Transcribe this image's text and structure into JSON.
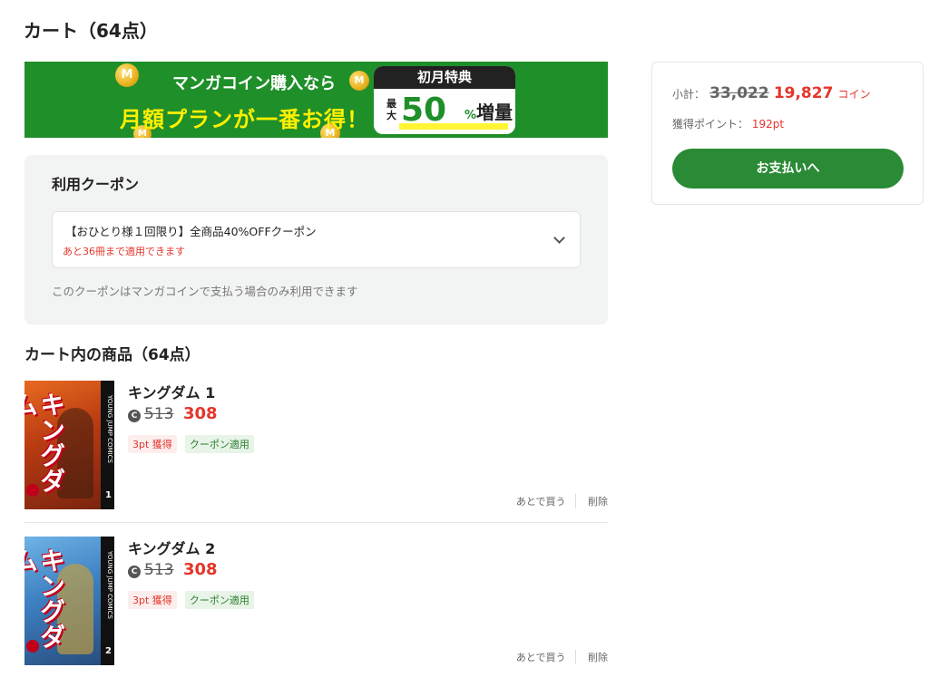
{
  "page": {
    "title": "カート（64点）"
  },
  "banner": {
    "line1": "マンガコイン購入なら",
    "line2": "月額プランが一番お得！",
    "badge_head": "初月特典",
    "badge_small": "最大",
    "badge_big": "50",
    "badge_pct": "%",
    "badge_word": "増量",
    "coin_letter": "M"
  },
  "coupon": {
    "title": "利用クーポン",
    "selected": "【おひとり様１回限り】全商品40%OFFクーポン",
    "remaining": "あと36冊まで適用できます",
    "note": "このクーポンはマンガコインで支払う場合のみ利用できます"
  },
  "items_section": {
    "title": "カート内の商品（64点）"
  },
  "items": [
    {
      "title": "キングダム 1",
      "coin_symbol": "C",
      "old_price": "513",
      "new_price": "308",
      "points_tag": "3pt 獲得",
      "coupon_tag": "クーポン適用",
      "later_label": "あとで買う",
      "delete_label": "削除",
      "cover_logo": "キングダム",
      "cover_spine": "YOUNG JUMP COMICS",
      "cover_vol": "1"
    },
    {
      "title": "キングダム 2",
      "coin_symbol": "C",
      "old_price": "513",
      "new_price": "308",
      "points_tag": "3pt 獲得",
      "coupon_tag": "クーポン適用",
      "later_label": "あとで買う",
      "delete_label": "削除",
      "cover_logo": "キングダム",
      "cover_spine": "YOUNG JUMP COMICS",
      "cover_vol": "2"
    }
  ],
  "summary": {
    "subtotal_label": "小計：",
    "old_total": "33,022",
    "new_total": "19,827",
    "unit": "コイン",
    "points_label": "獲得ポイント：",
    "points_value": "192pt",
    "pay_button": "お支払いへ"
  },
  "colors": {
    "brand_green": "#2a8a35",
    "banner_green": "#1f8f2a",
    "accent_red": "#e4352a"
  }
}
